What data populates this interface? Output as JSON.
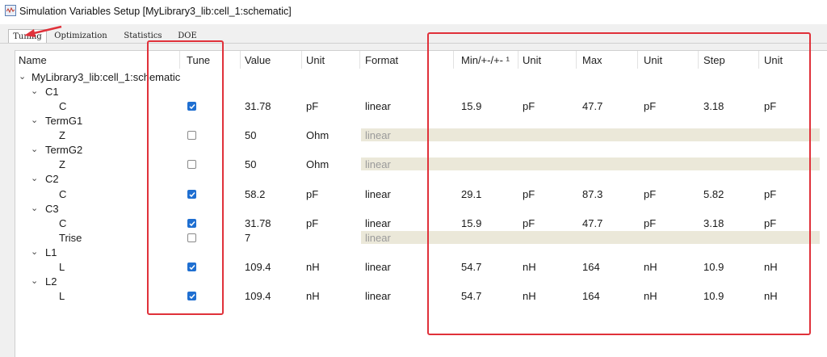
{
  "window": {
    "title": "Simulation Variables Setup [MyLibrary3_lib:cell_1:schematic]"
  },
  "tabs": [
    "Tuning",
    "Optimization",
    "Statistics",
    "DOE"
  ],
  "columns": [
    "Name",
    "Tune",
    "Value",
    "Unit",
    "Format",
    "Min/+-/+- ¹",
    "Unit",
    "Max",
    "Unit",
    "Step",
    "Unit"
  ],
  "root": "MyLibrary3_lib:cell_1:schematic",
  "groups": [
    "C1",
    "TermG1",
    "TermG2",
    "C2",
    "C3",
    "L1",
    "L2"
  ],
  "rows": [
    {
      "name": "C",
      "tune": true,
      "value": "31.78",
      "unit": "pF",
      "format": "linear",
      "min": "15.9",
      "min_unit": "pF",
      "max": "47.7",
      "max_unit": "pF",
      "step": "3.18",
      "step_unit": "pF"
    },
    {
      "name": "Z",
      "tune": false,
      "value": "50",
      "unit": "Ohm",
      "format": "linear",
      "min": "",
      "min_unit": "",
      "max": "",
      "max_unit": "",
      "step": "",
      "step_unit": ""
    },
    {
      "name": "Z",
      "tune": false,
      "value": "50",
      "unit": "Ohm",
      "format": "linear",
      "min": "",
      "min_unit": "",
      "max": "",
      "max_unit": "",
      "step": "",
      "step_unit": ""
    },
    {
      "name": "C",
      "tune": true,
      "value": "58.2",
      "unit": "pF",
      "format": "linear",
      "min": "29.1",
      "min_unit": "pF",
      "max": "87.3",
      "max_unit": "pF",
      "step": "5.82",
      "step_unit": "pF"
    },
    {
      "name": "C",
      "tune": true,
      "value": "31.78",
      "unit": "pF",
      "format": "linear",
      "min": "15.9",
      "min_unit": "pF",
      "max": "47.7",
      "max_unit": "pF",
      "step": "3.18",
      "step_unit": "pF"
    },
    {
      "name": "Trise",
      "tune": false,
      "value": "7",
      "unit": "",
      "format": "linear",
      "min": "",
      "min_unit": "",
      "max": "",
      "max_unit": "",
      "step": "",
      "step_unit": ""
    },
    {
      "name": "L",
      "tune": true,
      "value": "109.4",
      "unit": "nH",
      "format": "linear",
      "min": "54.7",
      "min_unit": "nH",
      "max": "164",
      "max_unit": "nH",
      "step": "10.9",
      "step_unit": "nH"
    },
    {
      "name": "L",
      "tune": true,
      "value": "109.4",
      "unit": "nH",
      "format": "linear",
      "min": "54.7",
      "min_unit": "nH",
      "max": "164",
      "max_unit": "nH",
      "step": "10.9",
      "step_unit": "nH"
    }
  ],
  "colors": {
    "highlight": "#e0313a",
    "checkbox_on": "#1f6fd1",
    "disabled_row": "#ebe8d9"
  }
}
